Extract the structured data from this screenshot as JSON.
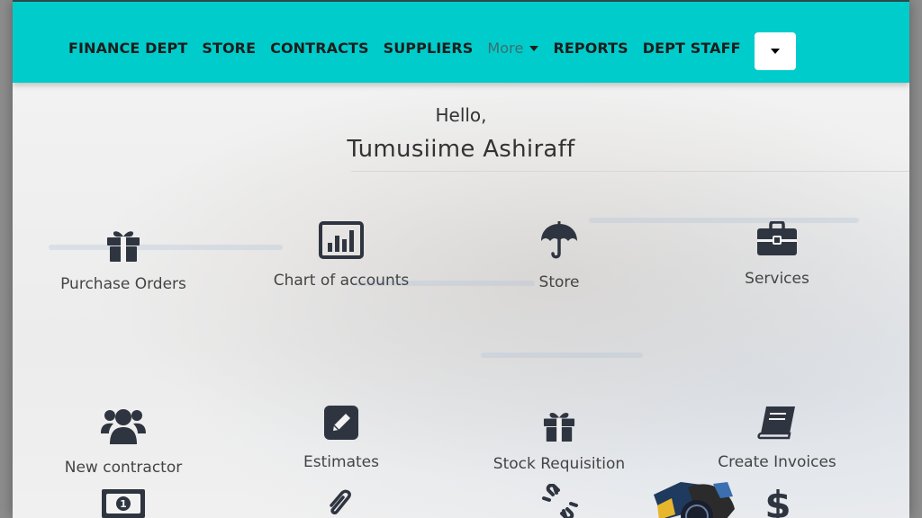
{
  "nav": {
    "items": [
      "FINANCE DEPT",
      "STORE",
      "CONTRACTS",
      "SUPPLIERS"
    ],
    "more_label": "More",
    "items_after": [
      "REPORTS",
      "DEPT STAFF"
    ]
  },
  "greeting": {
    "hello": "Hello,",
    "user_name": "Tumusiime Ashiraff"
  },
  "tiles": [
    {
      "label": "Purchase Orders",
      "icon": "gift-icon"
    },
    {
      "label": "Chart of accounts",
      "icon": "bar-chart-icon"
    },
    {
      "label": "Store",
      "icon": "umbrella-icon"
    },
    {
      "label": "Services",
      "icon": "briefcase-icon"
    },
    {
      "label": "New contractor",
      "icon": "users-icon"
    },
    {
      "label": "Estimates",
      "icon": "edit-icon"
    },
    {
      "label": "Stock Requisition",
      "icon": "gift-icon"
    },
    {
      "label": "Create Invoices",
      "icon": "book-icon"
    }
  ],
  "bottom_icons": [
    "money-bill-icon",
    "paperclip-icon",
    "unlink-icon",
    "dollar-icon"
  ],
  "colors": {
    "navbar": "#00cccb",
    "icon": "#2f3540",
    "text": "#444444"
  }
}
